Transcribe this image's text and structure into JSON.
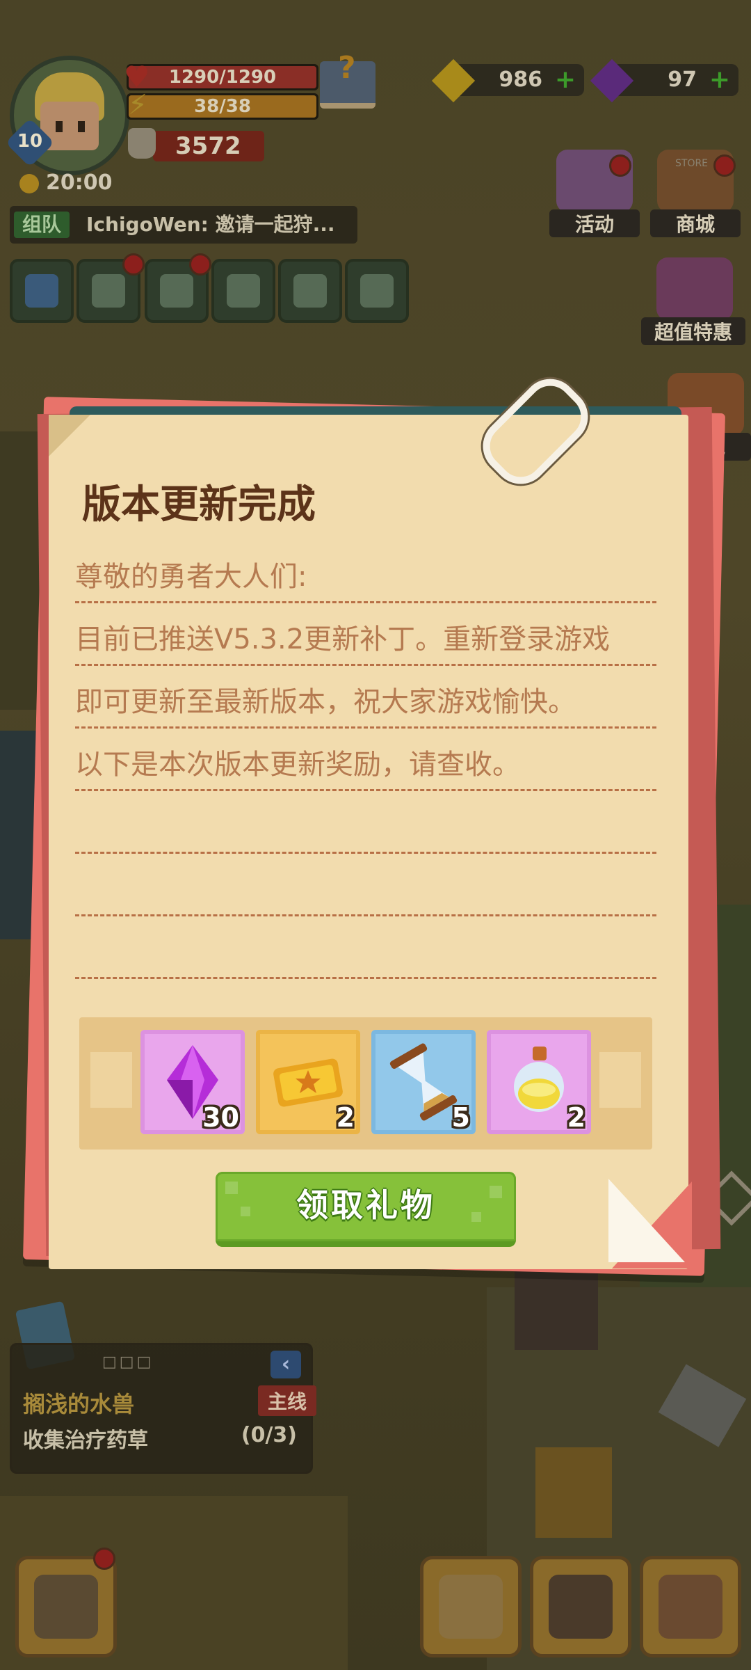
{
  "hud": {
    "level": "10",
    "hp": "1290/1290",
    "stamina": "38/38",
    "power": "3572",
    "timer": "20:00",
    "gold": "986",
    "gems": "97",
    "colors": {
      "hp": "#a3342c",
      "stamina": "#b7731e",
      "power": "#8e2a1e",
      "gold_icon": "#a88a1a",
      "gem_icon": "#6a2a8a"
    }
  },
  "chat": {
    "tag": "组队",
    "message": "IchigoWen: 邀请一起狩..."
  },
  "side_buttons": [
    {
      "label": "活动",
      "icon": "gift-box-icon"
    },
    {
      "label": "商城",
      "icon": "store-icon",
      "badge": "STORE"
    },
    {
      "label": "超值特惠",
      "icon": "special-offer-icon"
    },
    {
      "label": "礼包",
      "icon": "gift-pack-icon"
    }
  ],
  "toolbar_icons": [
    "expand-icon",
    "mail-icon",
    "friends-icon",
    "chat-icon",
    "map-icon",
    "notice-icon"
  ],
  "quest": {
    "title": "搁浅的水兽",
    "type": "主线",
    "task": "收集治疗药草",
    "progress": "(0/3)",
    "dots": "□□□"
  },
  "dialog": {
    "title": "版本更新完成",
    "lines": [
      "尊敬的勇者大人们:",
      "目前已推送V5.3.2更新补丁。重新登录游戏",
      "即可更新至最新版本，祝大家游戏愉快。",
      "以下是本次版本更新奖励，请查收。"
    ],
    "rewards": [
      {
        "icon": "purple-gem-icon",
        "count": "30",
        "bg": "#e9a6ec"
      },
      {
        "icon": "gold-ticket-icon",
        "count": "2",
        "bg": "#f4c35a"
      },
      {
        "icon": "hourglass-icon",
        "count": "5",
        "bg": "#92c8ea"
      },
      {
        "icon": "potion-icon",
        "count": "2",
        "bg": "#e9a6ec"
      }
    ],
    "claim_label": "领取礼物"
  }
}
